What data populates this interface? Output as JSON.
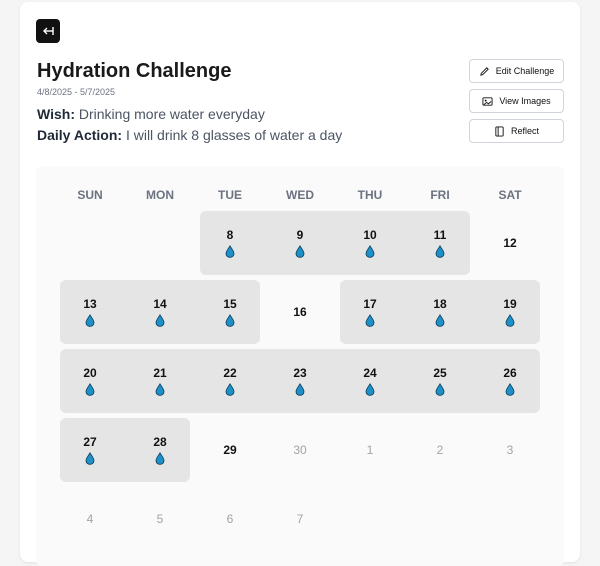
{
  "header": {
    "back_icon": "arrow-left-to-line-icon",
    "title": "Hydration Challenge",
    "dates": "4/8/2025 - 5/7/2025",
    "wish_label": "Wish:",
    "wish_text": "Drinking more water everyday",
    "action_label": "Daily Action:",
    "action_text": "I will drink 8 glasses of water a day"
  },
  "actions": {
    "edit": "Edit Challenge",
    "images": "View Images",
    "reflect": "Reflect"
  },
  "calendar": {
    "weekdays": [
      "SUN",
      "MON",
      "TUE",
      "WED",
      "THU",
      "FRI",
      "SAT"
    ],
    "drop_color": "#1e90c8",
    "weeks": [
      [
        {
          "day": "",
          "state": "empty"
        },
        {
          "day": "",
          "state": "empty"
        },
        {
          "day": "8",
          "state": "done"
        },
        {
          "day": "9",
          "state": "done"
        },
        {
          "day": "10",
          "state": "done"
        },
        {
          "day": "11",
          "state": "done"
        },
        {
          "day": "12",
          "state": "open"
        }
      ],
      [
        {
          "day": "13",
          "state": "done"
        },
        {
          "day": "14",
          "state": "done"
        },
        {
          "day": "15",
          "state": "done"
        },
        {
          "day": "16",
          "state": "open"
        },
        {
          "day": "17",
          "state": "done"
        },
        {
          "day": "18",
          "state": "done"
        },
        {
          "day": "19",
          "state": "done"
        }
      ],
      [
        {
          "day": "20",
          "state": "done"
        },
        {
          "day": "21",
          "state": "done"
        },
        {
          "day": "22",
          "state": "done"
        },
        {
          "day": "23",
          "state": "done"
        },
        {
          "day": "24",
          "state": "done"
        },
        {
          "day": "25",
          "state": "done"
        },
        {
          "day": "26",
          "state": "done"
        }
      ],
      [
        {
          "day": "27",
          "state": "done"
        },
        {
          "day": "28",
          "state": "done"
        },
        {
          "day": "29",
          "state": "open"
        },
        {
          "day": "30",
          "state": "future"
        },
        {
          "day": "1",
          "state": "future"
        },
        {
          "day": "2",
          "state": "future"
        },
        {
          "day": "3",
          "state": "future"
        }
      ],
      [
        {
          "day": "4",
          "state": "future"
        },
        {
          "day": "5",
          "state": "future"
        },
        {
          "day": "6",
          "state": "future"
        },
        {
          "day": "7",
          "state": "future"
        },
        {
          "day": "",
          "state": "empty"
        },
        {
          "day": "",
          "state": "empty"
        },
        {
          "day": "",
          "state": "empty"
        }
      ]
    ]
  }
}
